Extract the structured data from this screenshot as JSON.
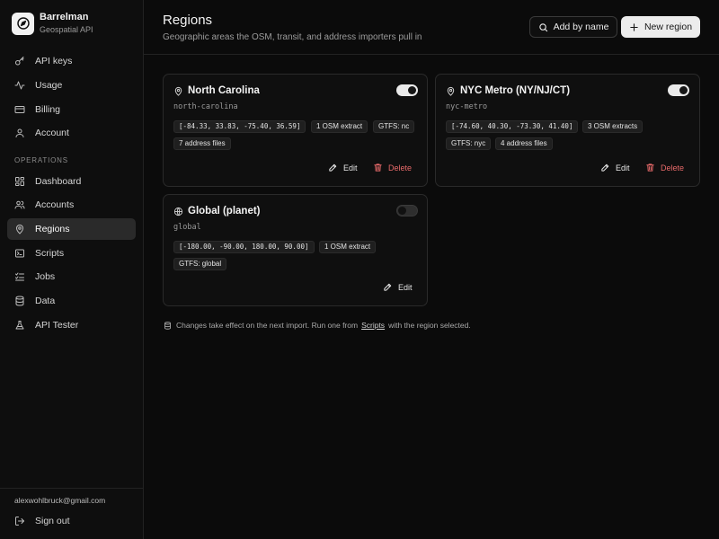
{
  "brand": {
    "name": "Barrelman",
    "subtitle": "Geospatial API",
    "icon": "compass-icon"
  },
  "sidebar": {
    "top_items": [
      {
        "label": "API keys",
        "icon": "key-icon"
      },
      {
        "label": "Usage",
        "icon": "activity-icon"
      },
      {
        "label": "Billing",
        "icon": "credit-card-icon"
      },
      {
        "label": "Account",
        "icon": "user-icon"
      }
    ],
    "section_label": "OPERATIONS",
    "ops_items": [
      {
        "label": "Dashboard",
        "icon": "dashboard-icon"
      },
      {
        "label": "Accounts",
        "icon": "users-icon"
      },
      {
        "label": "Regions",
        "icon": "map-pin-icon",
        "active": true
      },
      {
        "label": "Scripts",
        "icon": "terminal-icon"
      },
      {
        "label": "Jobs",
        "icon": "list-checks-icon"
      },
      {
        "label": "Data",
        "icon": "database-icon"
      },
      {
        "label": "API Tester",
        "icon": "flask-icon"
      }
    ],
    "user_email": "alexwohlbruck@gmail.com",
    "sign_out": "Sign out"
  },
  "header": {
    "title": "Regions",
    "subtitle": "Geographic areas the OSM, transit, and address importers pull in",
    "add_by_name": "Add by name",
    "new_region": "New region"
  },
  "regions": [
    {
      "name": "North Carolina",
      "slug": "north-carolina",
      "enabled": true,
      "bbox": "[-84.33, 33.83, -75.40, 36.59]",
      "osm": "1 OSM extract",
      "gtfs": "GTFS: nc",
      "address": "7 address files",
      "edit": "Edit",
      "delete": "Delete"
    },
    {
      "name": "NYC Metro (NY/NJ/CT)",
      "slug": "nyc-metro",
      "enabled": true,
      "bbox": "[-74.60, 40.30, -73.30, 41.40]",
      "osm": "3 OSM extracts",
      "gtfs": "GTFS: nyc",
      "address": "4 address files",
      "edit": "Edit",
      "delete": "Delete"
    },
    {
      "name": "Global (planet)",
      "slug": "global",
      "enabled": false,
      "bbox": "[-180.00, -90.00, 180.00, 90.00]",
      "osm": "1 OSM extract",
      "gtfs": "GTFS: global",
      "edit": "Edit"
    }
  ],
  "footnote": {
    "before": "Changes take effect on the next import. Run one from",
    "link": "Scripts",
    "after": "with the region selected."
  },
  "colors": {
    "danger": "#e86a6a",
    "background": "#0b0b0b",
    "primary_button": "#ececec"
  }
}
